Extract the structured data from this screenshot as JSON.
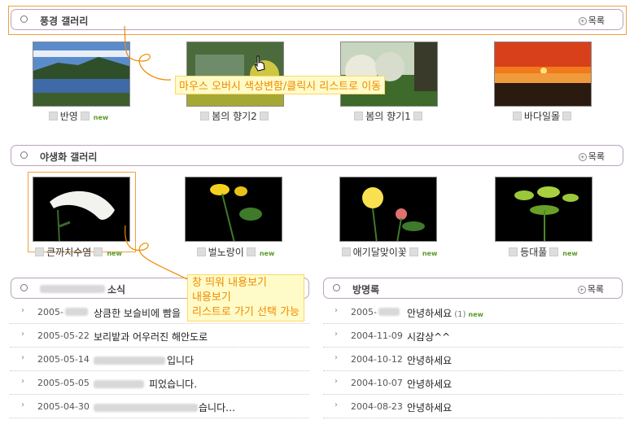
{
  "gallery1": {
    "title": "풍경 갤러리",
    "more": "목록",
    "items": [
      {
        "caption": "반영",
        "new": "new"
      },
      {
        "caption": "봄의 향기2",
        "new": ""
      },
      {
        "caption": "봄의 향기1",
        "new": ""
      },
      {
        "caption": "바다일몰",
        "new": ""
      }
    ]
  },
  "gallery2": {
    "title": "야생화 갤러리",
    "more": "목록",
    "items": [
      {
        "caption": "큰까치수염",
        "new": "new"
      },
      {
        "caption": "벌노랑이",
        "new": "new"
      },
      {
        "caption": "애기달맞이꽃",
        "new": "new"
      },
      {
        "caption": "등대풀",
        "new": "new"
      }
    ]
  },
  "news": {
    "title": "소식",
    "more": "목록",
    "rows": [
      {
        "date": "2005-",
        "text": "상큼한 보슬비에 빰을"
      },
      {
        "date": "2005-05-22",
        "text": "보리밭과 어우러진 해안도로"
      },
      {
        "date": "2005-05-14",
        "text": "입니다"
      },
      {
        "date": "2005-05-05",
        "text": "피었습니다."
      },
      {
        "date": "2005-04-30",
        "text": "습니다…"
      }
    ]
  },
  "guestbook": {
    "title": "방명록",
    "more": "목록",
    "rows": [
      {
        "date": "2005-",
        "text": "안녕하세요",
        "count": "(1)",
        "new": "new"
      },
      {
        "date": "2004-11-09",
        "text": "시감상^^",
        "count": "",
        "new": ""
      },
      {
        "date": "2004-10-12",
        "text": "안녕하세요",
        "count": "",
        "new": ""
      },
      {
        "date": "2004-10-07",
        "text": "안녕하세요",
        "count": "",
        "new": ""
      },
      {
        "date": "2004-08-23",
        "text": "안녕하세요",
        "count": "",
        "new": ""
      }
    ]
  },
  "annotations": {
    "hover": "마우스 오버시 색상변함/클릭시 리스트로 이동",
    "popup_line1": "창 띄워 내용보기",
    "popup_line2": "내용보기",
    "popup_line3": "리스트로 가기 선택 가능"
  },
  "colors": {
    "accent_frame": "#f0a040",
    "note_text": "#f08a00",
    "header_border": "#b9a3bd"
  }
}
